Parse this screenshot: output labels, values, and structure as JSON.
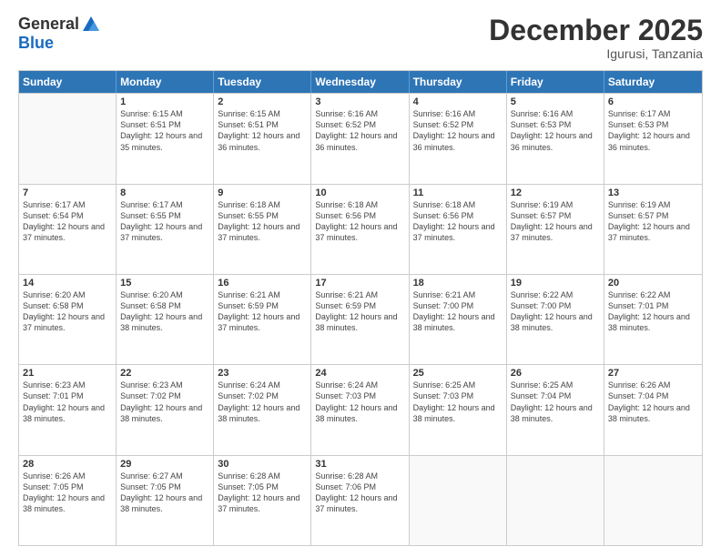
{
  "logo": {
    "general": "General",
    "blue": "Blue"
  },
  "header": {
    "month": "December 2025",
    "location": "Igurusi, Tanzania"
  },
  "weekdays": [
    "Sunday",
    "Monday",
    "Tuesday",
    "Wednesday",
    "Thursday",
    "Friday",
    "Saturday"
  ],
  "rows": [
    [
      {
        "day": "",
        "empty": true
      },
      {
        "day": "1",
        "sunrise": "6:15 AM",
        "sunset": "6:51 PM",
        "daylight": "12 hours and 35 minutes."
      },
      {
        "day": "2",
        "sunrise": "6:15 AM",
        "sunset": "6:51 PM",
        "daylight": "12 hours and 36 minutes."
      },
      {
        "day": "3",
        "sunrise": "6:16 AM",
        "sunset": "6:52 PM",
        "daylight": "12 hours and 36 minutes."
      },
      {
        "day": "4",
        "sunrise": "6:16 AM",
        "sunset": "6:52 PM",
        "daylight": "12 hours and 36 minutes."
      },
      {
        "day": "5",
        "sunrise": "6:16 AM",
        "sunset": "6:53 PM",
        "daylight": "12 hours and 36 minutes."
      },
      {
        "day": "6",
        "sunrise": "6:17 AM",
        "sunset": "6:53 PM",
        "daylight": "12 hours and 36 minutes."
      }
    ],
    [
      {
        "day": "7",
        "sunrise": "6:17 AM",
        "sunset": "6:54 PM",
        "daylight": "12 hours and 37 minutes."
      },
      {
        "day": "8",
        "sunrise": "6:17 AM",
        "sunset": "6:55 PM",
        "daylight": "12 hours and 37 minutes."
      },
      {
        "day": "9",
        "sunrise": "6:18 AM",
        "sunset": "6:55 PM",
        "daylight": "12 hours and 37 minutes."
      },
      {
        "day": "10",
        "sunrise": "6:18 AM",
        "sunset": "6:56 PM",
        "daylight": "12 hours and 37 minutes."
      },
      {
        "day": "11",
        "sunrise": "6:18 AM",
        "sunset": "6:56 PM",
        "daylight": "12 hours and 37 minutes."
      },
      {
        "day": "12",
        "sunrise": "6:19 AM",
        "sunset": "6:57 PM",
        "daylight": "12 hours and 37 minutes."
      },
      {
        "day": "13",
        "sunrise": "6:19 AM",
        "sunset": "6:57 PM",
        "daylight": "12 hours and 37 minutes."
      }
    ],
    [
      {
        "day": "14",
        "sunrise": "6:20 AM",
        "sunset": "6:58 PM",
        "daylight": "12 hours and 37 minutes."
      },
      {
        "day": "15",
        "sunrise": "6:20 AM",
        "sunset": "6:58 PM",
        "daylight": "12 hours and 38 minutes."
      },
      {
        "day": "16",
        "sunrise": "6:21 AM",
        "sunset": "6:59 PM",
        "daylight": "12 hours and 37 minutes."
      },
      {
        "day": "17",
        "sunrise": "6:21 AM",
        "sunset": "6:59 PM",
        "daylight": "12 hours and 38 minutes."
      },
      {
        "day": "18",
        "sunrise": "6:21 AM",
        "sunset": "7:00 PM",
        "daylight": "12 hours and 38 minutes."
      },
      {
        "day": "19",
        "sunrise": "6:22 AM",
        "sunset": "7:00 PM",
        "daylight": "12 hours and 38 minutes."
      },
      {
        "day": "20",
        "sunrise": "6:22 AM",
        "sunset": "7:01 PM",
        "daylight": "12 hours and 38 minutes."
      }
    ],
    [
      {
        "day": "21",
        "sunrise": "6:23 AM",
        "sunset": "7:01 PM",
        "daylight": "12 hours and 38 minutes."
      },
      {
        "day": "22",
        "sunrise": "6:23 AM",
        "sunset": "7:02 PM",
        "daylight": "12 hours and 38 minutes."
      },
      {
        "day": "23",
        "sunrise": "6:24 AM",
        "sunset": "7:02 PM",
        "daylight": "12 hours and 38 minutes."
      },
      {
        "day": "24",
        "sunrise": "6:24 AM",
        "sunset": "7:03 PM",
        "daylight": "12 hours and 38 minutes."
      },
      {
        "day": "25",
        "sunrise": "6:25 AM",
        "sunset": "7:03 PM",
        "daylight": "12 hours and 38 minutes."
      },
      {
        "day": "26",
        "sunrise": "6:25 AM",
        "sunset": "7:04 PM",
        "daylight": "12 hours and 38 minutes."
      },
      {
        "day": "27",
        "sunrise": "6:26 AM",
        "sunset": "7:04 PM",
        "daylight": "12 hours and 38 minutes."
      }
    ],
    [
      {
        "day": "28",
        "sunrise": "6:26 AM",
        "sunset": "7:05 PM",
        "daylight": "12 hours and 38 minutes."
      },
      {
        "day": "29",
        "sunrise": "6:27 AM",
        "sunset": "7:05 PM",
        "daylight": "12 hours and 38 minutes."
      },
      {
        "day": "30",
        "sunrise": "6:28 AM",
        "sunset": "7:05 PM",
        "daylight": "12 hours and 37 minutes."
      },
      {
        "day": "31",
        "sunrise": "6:28 AM",
        "sunset": "7:06 PM",
        "daylight": "12 hours and 37 minutes."
      },
      {
        "day": "",
        "empty": true
      },
      {
        "day": "",
        "empty": true
      },
      {
        "day": "",
        "empty": true
      }
    ]
  ],
  "labels": {
    "sunrise_prefix": "Sunrise: ",
    "sunset_prefix": "Sunset: ",
    "daylight_prefix": "Daylight: "
  }
}
